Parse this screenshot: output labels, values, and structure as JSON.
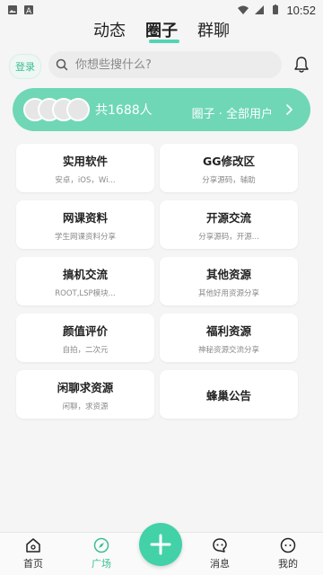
{
  "status_bar": {
    "time": "10:52",
    "left_icons": [
      "image-icon",
      "a-icon"
    ],
    "right_icons": [
      "wifi-icon",
      "signal-icon",
      "battery-icon"
    ]
  },
  "top_tabs": [
    {
      "label": "动态",
      "active": false
    },
    {
      "label": "圈子",
      "active": true
    },
    {
      "label": "群聊",
      "active": false
    }
  ],
  "header": {
    "login_label": "登录",
    "search_placeholder": "你想些搜什么?",
    "bell_icon": "bell-icon"
  },
  "banner": {
    "member_count_label": "共1688人",
    "title": "圈子 · 全部用户",
    "chevron_icon": "chevron-right-icon"
  },
  "categories": [
    {
      "title": "实用软件",
      "desc": "安卓，iOS，Wi..."
    },
    {
      "title": "GG修改区",
      "desc": "分享源码，辅助"
    },
    {
      "title": "网课资料",
      "desc": "学生网课资料分享"
    },
    {
      "title": "开源交流",
      "desc": "分享源码，开源..."
    },
    {
      "title": "搞机交流",
      "desc": "ROOT,LSP模块..."
    },
    {
      "title": "其他资源",
      "desc": "其他好用资源分享"
    },
    {
      "title": "颜值评价",
      "desc": "自拍，二次元"
    },
    {
      "title": "福利资源",
      "desc": "神秘资源交流分享"
    },
    {
      "title": "闲聊求资源",
      "desc": "闲聊，求资源"
    },
    {
      "title": "蜂巢公告",
      "desc": ""
    }
  ],
  "bottom_nav": {
    "items": [
      {
        "label": "首页",
        "icon": "home-icon",
        "active": false
      },
      {
        "label": "广场",
        "icon": "compass-icon",
        "active": true
      },
      {
        "label": "消息",
        "icon": "message-icon",
        "active": false
      },
      {
        "label": "我的",
        "icon": "profile-icon",
        "active": false
      }
    ],
    "fab_icon": "plus-icon"
  },
  "colors": {
    "accent": "#43d1a8",
    "banner": "#6fd7b6"
  }
}
